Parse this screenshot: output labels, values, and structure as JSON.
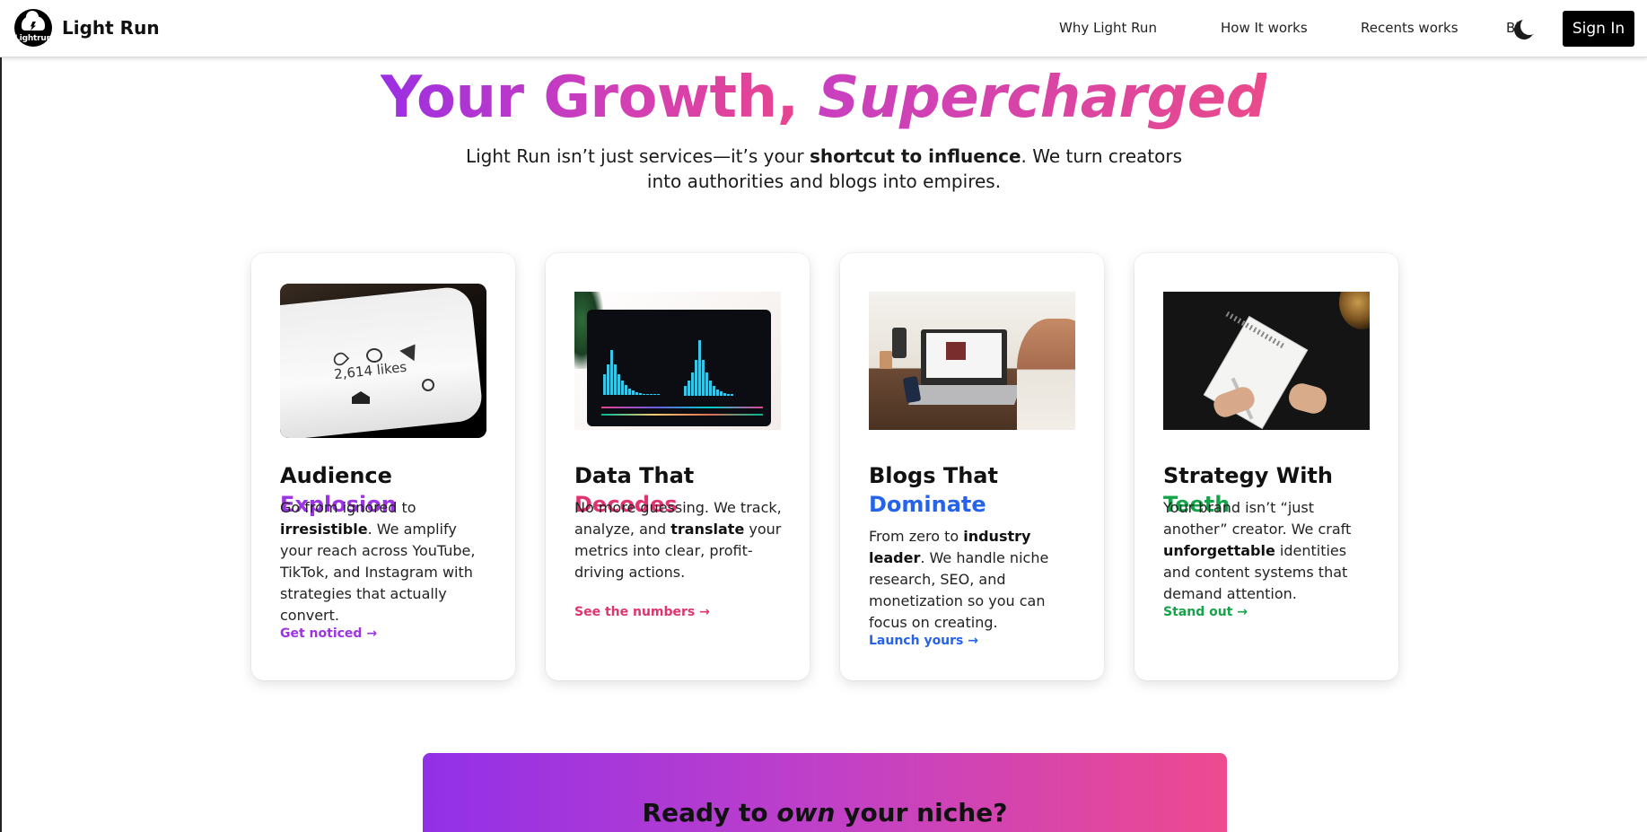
{
  "nav": {
    "logo_text": "Lightrun",
    "brand": "Light Run",
    "links": [
      "Why Light Run",
      "How It works",
      "Recents works",
      "Blog"
    ],
    "theme_icon": "moon-icon",
    "signin_label": "Sign In"
  },
  "hero": {
    "title_plain": "Your Growth,",
    "title_italic": "Supercharged",
    "subtitle_pre": "Light Run isn’t just services—it’s your ",
    "subtitle_bold": "shortcut to influence",
    "subtitle_post": ". We turn creators into authorities and blogs into empires.",
    "accent_start": "#9b2fe3",
    "accent_end": "#e8458f"
  },
  "cards": [
    {
      "image": "phone-likes-image",
      "image_text": "2,614 likes",
      "title_plain": "Audience ",
      "title_accent": "Explosion",
      "accent_color": "#9b34e3",
      "desc": [
        {
          "t": "Go from ignored to ",
          "b": false
        },
        {
          "t": "irresistible",
          "b": true
        },
        {
          "t": ". We amplify your reach across YouTube, TikTok, and Instagram with strategies that actually convert.",
          "b": false
        }
      ],
      "link": "Get noticed →"
    },
    {
      "image": "analytics-dashboard-image",
      "title_plain": "Data That ",
      "title_accent": "Decodes",
      "accent_color": "#e0346f",
      "desc": [
        {
          "t": "No more guessing. We track, analyze, and ",
          "b": false
        },
        {
          "t": "translate",
          "b": true
        },
        {
          "t": " your metrics into clear, profit-driving actions.",
          "b": false
        }
      ],
      "link": "See the numbers →"
    },
    {
      "image": "blogger-laptop-image",
      "title_plain": "Blogs That ",
      "title_accent": "Dominate",
      "accent_color": "#2563eb",
      "desc": [
        {
          "t": "From zero to ",
          "b": false
        },
        {
          "t": "industry leader",
          "b": true
        },
        {
          "t": ". We handle niche research, SEO, and monetization so you can focus on creating.",
          "b": false
        }
      ],
      "link": "Launch yours →"
    },
    {
      "image": "notepad-strategy-image",
      "title_plain": "Strategy With ",
      "title_accent": "Teeth",
      "accent_color": "#16a34a",
      "desc": [
        {
          "t": "Your brand isn’t “just another” creator. We craft ",
          "b": false
        },
        {
          "t": "unforgettable",
          "b": true
        },
        {
          "t": " identities and content systems that demand attention.",
          "b": false
        }
      ],
      "link": "Stand out →"
    }
  ],
  "cta": {
    "title_pre": "Ready to ",
    "title_italic": "own",
    "title_post": " your niche?"
  }
}
